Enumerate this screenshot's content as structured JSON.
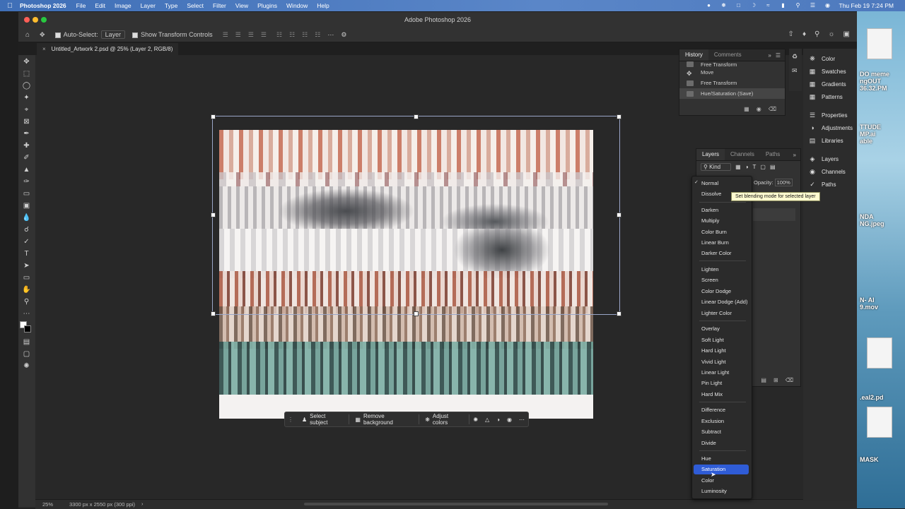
{
  "menubar": {
    "app_name": "Photoshop 2026",
    "items": [
      "File",
      "Edit",
      "Image",
      "Layer",
      "Type",
      "Select",
      "Filter",
      "View",
      "Plugins",
      "Window",
      "Help"
    ],
    "clock": "Thu Feb 19  7:24 PM"
  },
  "window": {
    "title": "Adobe Photoshop 2026"
  },
  "options_bar": {
    "auto_select_label": "Auto-Select:",
    "auto_select_value": "Layer",
    "transform_controls_label": "Show Transform Controls"
  },
  "document_tab": {
    "label": "Untitled_Artwork 2.psd @ 25% (Layer 2, RGB/8)"
  },
  "history_panel": {
    "tabs": [
      "History",
      "Comments"
    ],
    "rows": [
      "Free Transform",
      "Move",
      "Free Transform",
      "Hue/Saturation (Save)"
    ]
  },
  "layers_panel": {
    "tabs": [
      "Layers",
      "Channels",
      "Paths"
    ],
    "kind_label": "Kind",
    "opacity_label": "Opacity:",
    "opacity_value": "100%"
  },
  "blend_menu": {
    "groups": [
      [
        "Normal",
        "Dissolve"
      ],
      [
        "Darken",
        "Multiply",
        "Color Burn",
        "Linear Burn",
        "Darker Color"
      ],
      [
        "Lighten",
        "Screen",
        "Color Dodge",
        "Linear Dodge (Add)",
        "Lighter Color"
      ],
      [
        "Overlay",
        "Soft Light",
        "Hard Light",
        "Vivid Light",
        "Linear Light",
        "Pin Light",
        "Hard Mix"
      ],
      [
        "Difference",
        "Exclusion",
        "Subtract",
        "Divide"
      ],
      [
        "Hue",
        "Saturation",
        "Color",
        "Luminosity"
      ]
    ],
    "checked": "Normal",
    "highlighted": "Saturation",
    "tooltip": "Set blending mode for selected layer"
  },
  "dock": {
    "items": [
      "Color",
      "Swatches",
      "Gradients",
      "Patterns",
      "Properties",
      "Adjustments",
      "Libraries",
      "Layers",
      "Channels",
      "Paths"
    ]
  },
  "context_bar": {
    "select_subject": "Select subject",
    "remove_background": "Remove background",
    "adjust_colors": "Adjust colors"
  },
  "status_bar": {
    "zoom": "25%",
    "doc_info": "3300 px x 2550 px (300 ppi)"
  },
  "desktop_files": [
    "DO meme",
    "ngOUT",
    "36.32.PM",
    "TTUDE",
    "MP.ai",
    "able",
    "NDA",
    "NG.jpeg",
    "N- AI",
    "9.mov",
    ".eal2.pd",
    "MASK"
  ],
  "colors": {
    "accent": "#2f5cd6",
    "menubar": "#4d79bd",
    "panel": "#323232"
  }
}
